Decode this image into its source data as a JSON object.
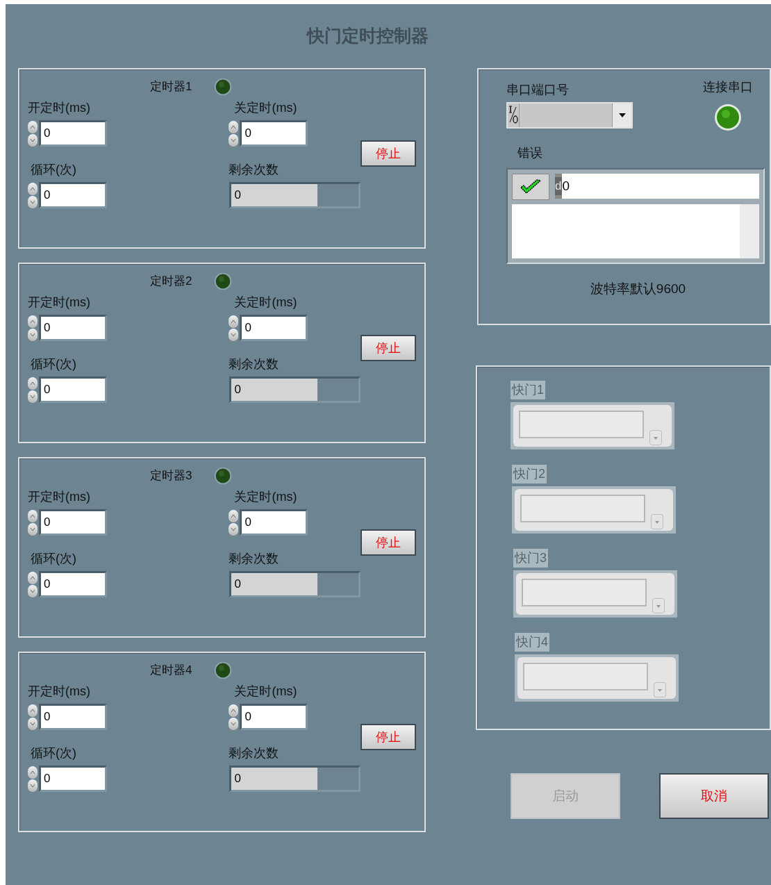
{
  "title": "快门定时控制器",
  "timers": [
    {
      "title": "定时器1",
      "led_on": false,
      "on_label": "开定时(ms)",
      "on_value": "0",
      "off_label": "关定时(ms)",
      "off_value": "0",
      "loop_label": "循环(次)",
      "loop_value": "0",
      "remaining_label": "剩余次数",
      "remaining_value": "0",
      "stop_button": "停止"
    },
    {
      "title": "定时器2",
      "led_on": false,
      "on_label": "开定时(ms)",
      "on_value": "0",
      "off_label": "关定时(ms)",
      "off_value": "0",
      "loop_label": "循环(次)",
      "loop_value": "0",
      "remaining_label": "剩余次数",
      "remaining_value": "0",
      "stop_button": "停止"
    },
    {
      "title": "定时器3",
      "led_on": false,
      "on_label": "开定时(ms)",
      "on_value": "0",
      "off_label": "关定时(ms)",
      "off_value": "0",
      "loop_label": "循环(次)",
      "loop_value": "0",
      "remaining_label": "剩余次数",
      "remaining_value": "0",
      "stop_button": "停止"
    },
    {
      "title": "定时器4",
      "led_on": false,
      "on_label": "开定时(ms)",
      "on_value": "0",
      "off_label": "关定时(ms)",
      "off_value": "0",
      "loop_label": "循环(次)",
      "loop_value": "0",
      "remaining_label": "剩余次数",
      "remaining_value": "0",
      "stop_button": "停止"
    }
  ],
  "serial": {
    "port_label": "串口端口号",
    "connect_label": "连接串口",
    "connect_on": true,
    "error_label": "错误",
    "status_ok": true,
    "code_radix": "d",
    "code": "0",
    "baud_note": "波特率默认9600"
  },
  "shutters": [
    {
      "label": "快门1",
      "disabled": true
    },
    {
      "label": "快门2",
      "disabled": true
    },
    {
      "label": "快门3",
      "disabled": true
    },
    {
      "label": "快门4",
      "disabled": true
    }
  ],
  "buttons": [
    {
      "label": "启动",
      "disabled": true
    },
    {
      "label": "取消",
      "disabled": false
    }
  ]
}
